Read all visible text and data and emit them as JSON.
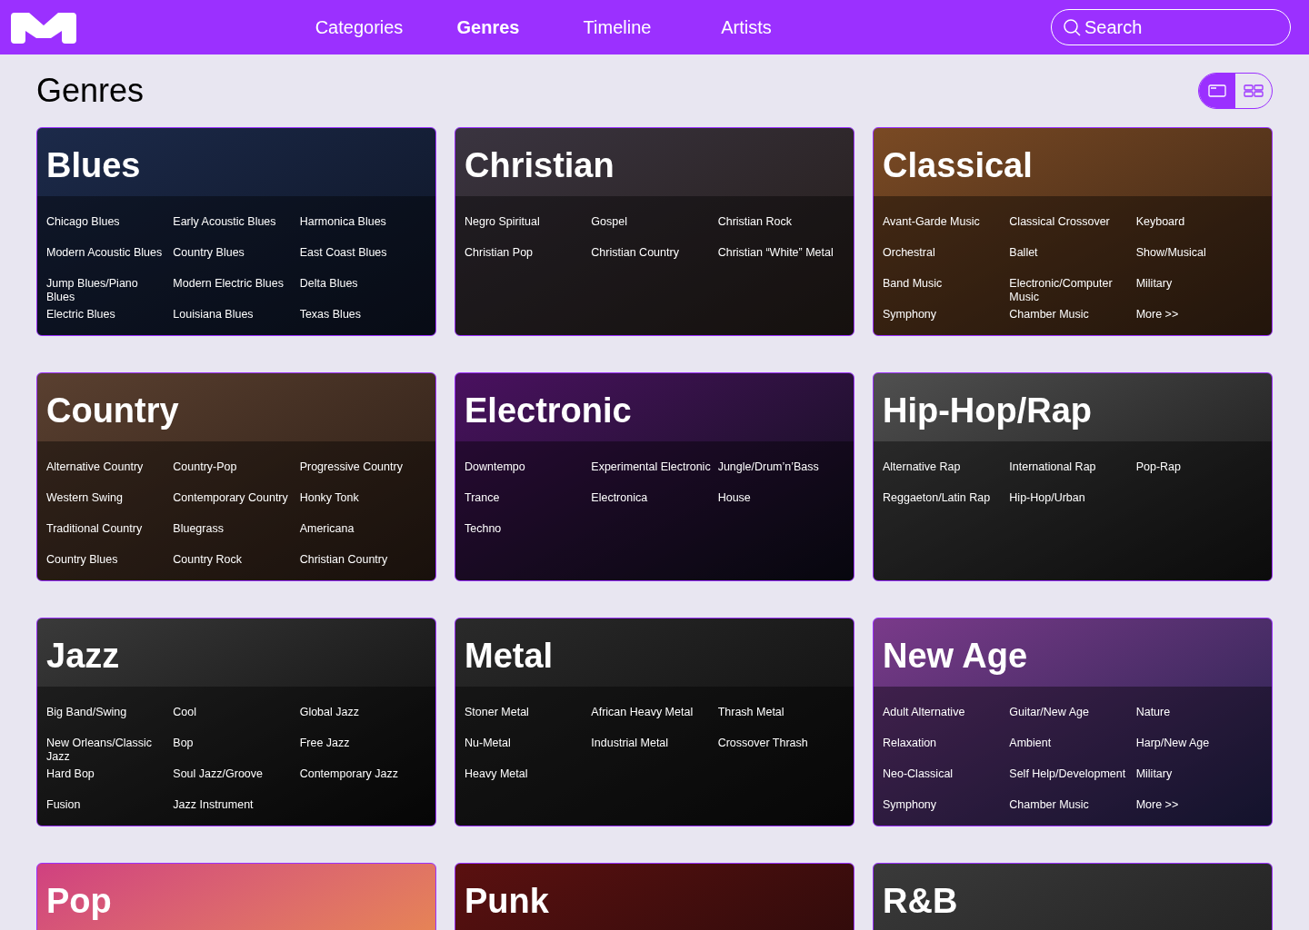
{
  "nav": {
    "links": [
      {
        "label": "Categories",
        "selected": false
      },
      {
        "label": "Genres",
        "selected": true
      },
      {
        "label": "Timeline",
        "selected": false
      },
      {
        "label": "Artists",
        "selected": false
      }
    ],
    "search": {
      "placeholder": "Search"
    }
  },
  "page": {
    "title": "Genres"
  },
  "view_toggle": [
    {
      "kind": "single",
      "selected": true
    },
    {
      "kind": "grid",
      "selected": false
    }
  ],
  "genres": [
    {
      "title": "Blues",
      "subgenres": [
        "Chicago Blues",
        "Early Acoustic Blues",
        "Harmonica Blues",
        "Modern Acoustic Blues",
        "Country Blues",
        "East Coast Blues",
        "Jump Blues/Piano Blues",
        "Modern Electric Blues",
        "Delta Blues",
        "Electric Blues",
        "Louisiana Blues",
        "Texas Blues"
      ]
    },
    {
      "title": "Christian",
      "subgenres": [
        "Negro Spiritual",
        "Gospel",
        "Christian Rock",
        "Christian Pop",
        "Christian Country",
        "Christian “White” Metal"
      ]
    },
    {
      "title": "Classical",
      "subgenres": [
        "Avant-Garde Music",
        "Classical Crossover",
        "Keyboard",
        "Orchestral",
        "Ballet",
        "Show/Musical",
        "Band Music",
        "Electronic/Computer Music",
        "Military",
        "Symphony",
        "Chamber Music",
        "More >>"
      ]
    },
    {
      "title": "Country",
      "subgenres": [
        "Alternative Country",
        "Country-Pop",
        "Progressive Country",
        "Western Swing",
        "Contemporary Country",
        "Honky Tonk",
        "Traditional Country",
        "Bluegrass",
        "Americana",
        "Country Blues",
        "Country Rock",
        "Christian Country"
      ]
    },
    {
      "title": "Electronic",
      "subgenres": [
        "Downtempo",
        "Experimental Electronic",
        "Jungle/Drum’n’Bass",
        "Trance",
        "Electronica",
        "House",
        "Techno"
      ]
    },
    {
      "title": "Hip-Hop/Rap",
      "subgenres": [
        "Alternative Rap",
        "International Rap",
        "Pop-Rap",
        "Reggaeton/Latin Rap",
        "Hip-Hop/Urban"
      ]
    },
    {
      "title": "Jazz",
      "subgenres": [
        "Big Band/Swing",
        "Cool",
        "Global Jazz",
        "New Orleans/Classic Jazz",
        "Bop",
        "Free Jazz",
        "Hard Bop",
        "Soul Jazz/Groove",
        "Contemporary Jazz",
        "Fusion",
        "Jazz Instrument"
      ]
    },
    {
      "title": "Metal",
      "subgenres": [
        "Stoner Metal",
        "African Heavy Metal",
        "Thrash Metal",
        "Nu-Metal",
        "Industrial Metal",
        "Crossover Thrash",
        "Heavy Metal"
      ]
    },
    {
      "title": "New Age",
      "subgenres": [
        "Adult Alternative",
        "Guitar/New Age",
        "Nature",
        "Relaxation",
        "Ambient",
        "Harp/New Age",
        "Neo-Classical",
        "Self Help/Development",
        "Military",
        "Symphony",
        "Chamber Music",
        "More >>"
      ]
    },
    {
      "title": "Pop"
    },
    {
      "title": "Punk"
    },
    {
      "title": "R&B"
    }
  ]
}
